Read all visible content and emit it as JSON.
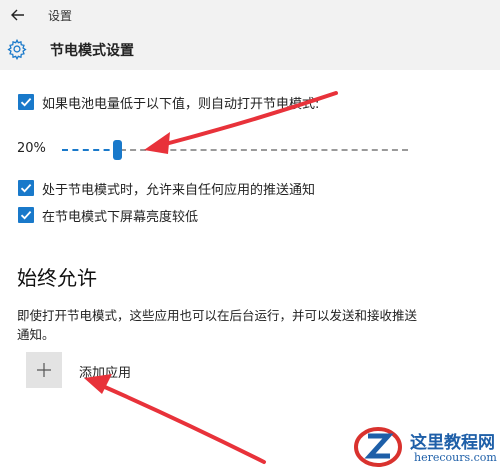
{
  "titlebar": {
    "title": "设置",
    "back_icon": "arrow-left-icon"
  },
  "header": {
    "icon": "gear-icon",
    "title": "节电模式设置"
  },
  "auto_on": {
    "checked": true,
    "label": "如果电池电量低于以下值，则自动打开节电模式:"
  },
  "threshold": {
    "value_text": "20%",
    "value": 20,
    "min": 0,
    "max": 100
  },
  "options": [
    {
      "checked": true,
      "label": "处于节电模式时，允许来自任何应用的推送通知"
    },
    {
      "checked": true,
      "label": "在节电模式下屏幕亮度较低"
    }
  ],
  "always_allow": {
    "title": "始终允许",
    "description": "即使打开节电模式，这些应用也可以在后台运行，并可以发送和接收推送通知。",
    "add_icon": "plus-icon",
    "add_label": "添加应用"
  },
  "watermark": {
    "name": "这里教程网",
    "url": "herecours.com"
  },
  "colors": {
    "accent": "#1979ca",
    "arrow": "#e8323a",
    "header_bg": "#f2f2f2"
  }
}
